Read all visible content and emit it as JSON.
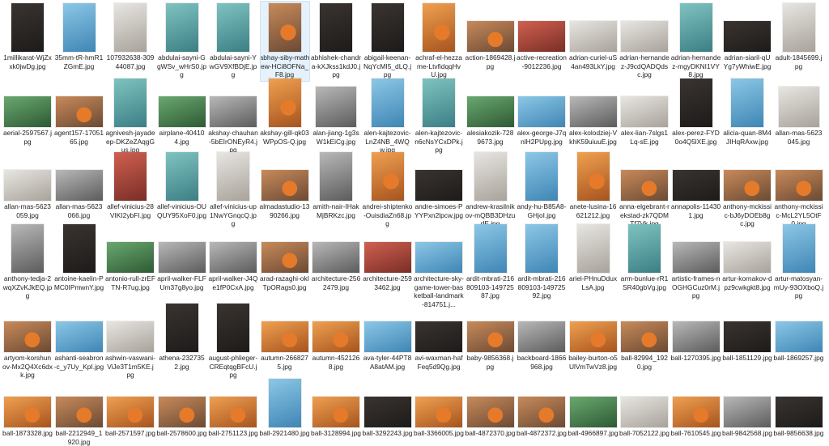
{
  "files": [
    {
      "name": "1millikarat-WjZxxk0jwDg.jpg",
      "shape": "portrait",
      "tone": "dark"
    },
    {
      "name": "35mm-tR-hmR1ZGmE.jpg",
      "shape": "portrait",
      "tone": "blue"
    },
    {
      "name": "107932638-30944087.jpg",
      "shape": "portrait",
      "tone": "light"
    },
    {
      "name": "abdulai-sayni-GgWSv_wHrS0.jpg",
      "shape": "portrait",
      "tone": "teal"
    },
    {
      "name": "abdulai-sayni-YwGV9XfBDjE.jpg",
      "shape": "portrait",
      "tone": "teal"
    },
    {
      "name": "abhay-siby-mathew-HCi8OFNa_F8.jpg",
      "shape": "portrait",
      "tone": "warm",
      "selected": true
    },
    {
      "name": "abhishek-chandra-kXJkss1kdJ0.jpg",
      "shape": "portrait",
      "tone": "dark"
    },
    {
      "name": "abigail-keenan-NqYcMI5_dLQ.jpg",
      "shape": "portrait",
      "tone": "dark"
    },
    {
      "name": "achraf-el-hezzame-LtvfidqqHvU.jpg",
      "shape": "portrait",
      "tone": "orange"
    },
    {
      "name": "action-1869428.jpg",
      "shape": "landscape",
      "tone": "warm"
    },
    {
      "name": "active-recreation-9012236.jpg",
      "shape": "landscape",
      "tone": "red"
    },
    {
      "name": "adrian-curiel-uS4an493LkY.jpg",
      "shape": "landscape",
      "tone": "light"
    },
    {
      "name": "adrian-hernandez-J9cdQADQdsc.jpg",
      "shape": "landscape",
      "tone": "light"
    },
    {
      "name": "adrian-hernandez-mgyDKNI1VY8.jpg",
      "shape": "portrait",
      "tone": "teal"
    },
    {
      "name": "adrian-siaril-qUYg7yWhiwE.jpg",
      "shape": "landscape",
      "tone": "dark"
    },
    {
      "name": "adult-1845699.jpg",
      "shape": "portrait",
      "tone": "light"
    },
    {
      "name": "aerial-2597567.jpg",
      "shape": "landscape",
      "tone": "green"
    },
    {
      "name": "agent157-1705165.jpg",
      "shape": "landscape",
      "tone": "warm"
    },
    {
      "name": "agnivesh-jayadeep-DKZeZAqgGus.jpg",
      "shape": "portrait",
      "tone": "teal"
    },
    {
      "name": "airplane-404104.jpg",
      "shape": "landscape",
      "tone": "green"
    },
    {
      "name": "akshay-chauhan-5bEIrONEyR4.jpg",
      "shape": "landscape",
      "tone": "gray"
    },
    {
      "name": "akshay-gill-qk03WPpOS-Q.jpg",
      "shape": "portrait",
      "tone": "orange"
    },
    {
      "name": "alan-jiang-1g3sW1kEiCg.jpg",
      "shape": "square",
      "tone": "gray"
    },
    {
      "name": "alen-kajtezovic-LnZ4NB_4WQw.jpg",
      "shape": "portrait",
      "tone": "blue"
    },
    {
      "name": "alen-kajtezovic-n6cNsYCxDPk.jpg",
      "shape": "portrait",
      "tone": "teal"
    },
    {
      "name": "alesiakozik-7289673.jpg",
      "shape": "landscape",
      "tone": "green"
    },
    {
      "name": "alex-george-J7qnlH2PUpg.jpg",
      "shape": "landscape",
      "tone": "blue"
    },
    {
      "name": "alex-kolodziej-VkhK59uiuuE.jpg",
      "shape": "landscape",
      "tone": "gray"
    },
    {
      "name": "alex-lian-7slgs1Lq-sE.jpg",
      "shape": "landscape",
      "tone": "light"
    },
    {
      "name": "alex-perez-FYD0o4Q5lXE.jpg",
      "shape": "portrait",
      "tone": "dark"
    },
    {
      "name": "alicia-quan-8M4JIHqRAxw.jpg",
      "shape": "portrait",
      "tone": "blue"
    },
    {
      "name": "allan-mas-5623045.jpg",
      "shape": "square",
      "tone": "light"
    },
    {
      "name": "allan-mas-5623059.jpg",
      "shape": "landscape",
      "tone": "light"
    },
    {
      "name": "allan-mas-5623066.jpg",
      "shape": "landscape",
      "tone": "gray"
    },
    {
      "name": "allef-vinicius-28VIKI2ybFI.jpg",
      "shape": "portrait",
      "tone": "red"
    },
    {
      "name": "allef-vinicius-OUQUY95XoF0.jpg",
      "shape": "portrait",
      "tone": "teal"
    },
    {
      "name": "allef-vinicius-up1NwYGnqcQ.jpg",
      "shape": "portrait",
      "tone": "light"
    },
    {
      "name": "almadastudio-1390266.jpg",
      "shape": "landscape",
      "tone": "warm"
    },
    {
      "name": "amith-nair-IHakMjBRKzc.jpg",
      "shape": "portrait",
      "tone": "gray"
    },
    {
      "name": "andrei-shiptenko-OuisdiaZn68.jpg",
      "shape": "portrait",
      "tone": "orange"
    },
    {
      "name": "andre-simoes-PYYPxn2lpcw.jpg",
      "shape": "landscape",
      "tone": "dark"
    },
    {
      "name": "andrew-krasilnikov-mQBB3DHzudE.jpg",
      "shape": "portrait",
      "tone": "light"
    },
    {
      "name": "andy-hu-B85A8-GHjoI.jpg",
      "shape": "portrait",
      "tone": "blue"
    },
    {
      "name": "anete-lusina-16621212.jpg",
      "shape": "portrait",
      "tone": "orange"
    },
    {
      "name": "anna-elgebrant-rekstad-zk7QDMTf7Vk.jpg",
      "shape": "landscape",
      "tone": "warm"
    },
    {
      "name": "annapolis-114301.jpg",
      "shape": "landscape",
      "tone": "dark"
    },
    {
      "name": "anthony-mckissic-bJ6yDOEb8gc.jpg",
      "shape": "landscape",
      "tone": "warm"
    },
    {
      "name": "anthony-mckissic-McL2YL5OtF0.jpg",
      "shape": "landscape",
      "tone": "warm"
    },
    {
      "name": "anthony-tedja-2wqXZvKJkEQ.jpg",
      "shape": "portrait",
      "tone": "gray"
    },
    {
      "name": "antoine-kaelin-PMC0IPmwnY.jpg",
      "shape": "portrait",
      "tone": "dark"
    },
    {
      "name": "antonio-rull-zrEFTN-R7ug.jpg",
      "shape": "landscape",
      "tone": "green"
    },
    {
      "name": "april-walker-FLFUm37g8yo.jpg",
      "shape": "landscape",
      "tone": "gray"
    },
    {
      "name": "april-walker-J4Qe1fP0CxA.jpg",
      "shape": "landscape",
      "tone": "gray"
    },
    {
      "name": "arad-razaghi-okITpORags0.jpg",
      "shape": "landscape",
      "tone": "warm"
    },
    {
      "name": "architecture-2562479.jpg",
      "shape": "landscape",
      "tone": "gray"
    },
    {
      "name": "architecture-2593462.jpg",
      "shape": "landscape",
      "tone": "red"
    },
    {
      "name": "architecture-sky-game-tower-basketball-landmark-814751.j...",
      "shape": "landscape",
      "tone": "blue"
    },
    {
      "name": "ardit-mbrati-216809103-14972587.jpg",
      "shape": "portrait",
      "tone": "blue"
    },
    {
      "name": "ardit-mbrati-216809103-14972592.jpg",
      "shape": "portrait",
      "tone": "blue"
    },
    {
      "name": "ariel-PHnuDduxLsA.jpg",
      "shape": "portrait",
      "tone": "light"
    },
    {
      "name": "arm-bunlue-rR1SR40gbVg.jpg",
      "shape": "portrait",
      "tone": "teal"
    },
    {
      "name": "artistic-frames-nOGHGCuz0rM.jpg",
      "shape": "landscape",
      "tone": "gray"
    },
    {
      "name": "artur-kornakov-dpz9cwkgkt8.jpg",
      "shape": "landscape",
      "tone": "light"
    },
    {
      "name": "artur-matosyan-mUy-93OXboQ.jpg",
      "shape": "portrait",
      "tone": "blue"
    },
    {
      "name": "artyom-korshunov-Mx2Q4Xc6dxk.jpg",
      "shape": "landscape",
      "tone": "warm"
    },
    {
      "name": "ashanti-seabron-c_y7Uy_KpI.jpg",
      "shape": "landscape",
      "tone": "blue"
    },
    {
      "name": "ashwin-vaswani-ViJe3T1m5KE.jpg",
      "shape": "landscape",
      "tone": "light"
    },
    {
      "name": "athena-2327352.jpg",
      "shape": "portrait",
      "tone": "dark"
    },
    {
      "name": "august-phlieger-CREqtqgBFcU.jpg",
      "shape": "portrait",
      "tone": "dark"
    },
    {
      "name": "autumn-2668275.jpg",
      "shape": "landscape",
      "tone": "orange"
    },
    {
      "name": "autumn-4521268.jpg",
      "shape": "landscape",
      "tone": "orange"
    },
    {
      "name": "ava-tyler-44PT8A8atAM.jpg",
      "shape": "landscape",
      "tone": "blue"
    },
    {
      "name": "avi-waxman-hafFeq5d9Qg.jpg",
      "shape": "landscape",
      "tone": "dark"
    },
    {
      "name": "baby-9856368.jpg",
      "shape": "landscape",
      "tone": "warm"
    },
    {
      "name": "backboard-1866968.jpg",
      "shape": "landscape",
      "tone": "gray"
    },
    {
      "name": "bailey-burton-o5UlVmTwVz8.jpg",
      "shape": "landscape",
      "tone": "orange"
    },
    {
      "name": "ball-82994_1920.jpg",
      "shape": "landscape",
      "tone": "warm"
    },
    {
      "name": "ball-1270395.jpg",
      "shape": "landscape",
      "tone": "gray"
    },
    {
      "name": "ball-1851129.jpg",
      "shape": "landscape",
      "tone": "dark"
    },
    {
      "name": "ball-1869257.jpg",
      "shape": "landscape",
      "tone": "blue"
    },
    {
      "name": "ball-1873328.jpg",
      "shape": "landscape",
      "tone": "orange"
    },
    {
      "name": "ball-2212949_1920.jpg",
      "shape": "landscape",
      "tone": "warm"
    },
    {
      "name": "ball-2571597.jpg",
      "shape": "landscape",
      "tone": "orange"
    },
    {
      "name": "ball-2578600.jpg",
      "shape": "landscape",
      "tone": "warm"
    },
    {
      "name": "ball-2751123.jpg",
      "shape": "landscape",
      "tone": "orange"
    },
    {
      "name": "ball-2921480.jpg",
      "shape": "portrait",
      "tone": "blue"
    },
    {
      "name": "ball-3128994.jpg",
      "shape": "landscape",
      "tone": "orange"
    },
    {
      "name": "ball-3292243.jpg",
      "shape": "landscape",
      "tone": "dark"
    },
    {
      "name": "ball-3366005.jpg",
      "shape": "landscape",
      "tone": "orange"
    },
    {
      "name": "ball-4872370.jpg",
      "shape": "landscape",
      "tone": "warm"
    },
    {
      "name": "ball-4872372.jpg",
      "shape": "landscape",
      "tone": "warm"
    },
    {
      "name": "ball-4966897.jpg",
      "shape": "landscape",
      "tone": "green"
    },
    {
      "name": "ball-7052122.jpg",
      "shape": "landscape",
      "tone": "light"
    },
    {
      "name": "ball-7610545.jpg",
      "shape": "landscape",
      "tone": "orange"
    },
    {
      "name": "ball-9842568.jpg",
      "shape": "landscape",
      "tone": "gray"
    },
    {
      "name": "ball-9856638.jpg",
      "shape": "landscape",
      "tone": "dark"
    }
  ],
  "tones": {
    "dark": [
      "#3a3430",
      "#1d1b1a"
    ],
    "blue": [
      "#8cc7e6",
      "#3f86b5"
    ],
    "light": [
      "#e8e6e2",
      "#a8a29a"
    ],
    "teal": [
      "#7fc3c0",
      "#3b7f85"
    ],
    "warm": [
      "#c88a5a",
      "#6b4a34"
    ],
    "orange": [
      "#f0a050",
      "#a6541e"
    ],
    "red": [
      "#d06050",
      "#7a2e26"
    ],
    "green": [
      "#6aa870",
      "#2e5a34"
    ],
    "gray": [
      "#b8b8b8",
      "#5c5c5c"
    ]
  }
}
